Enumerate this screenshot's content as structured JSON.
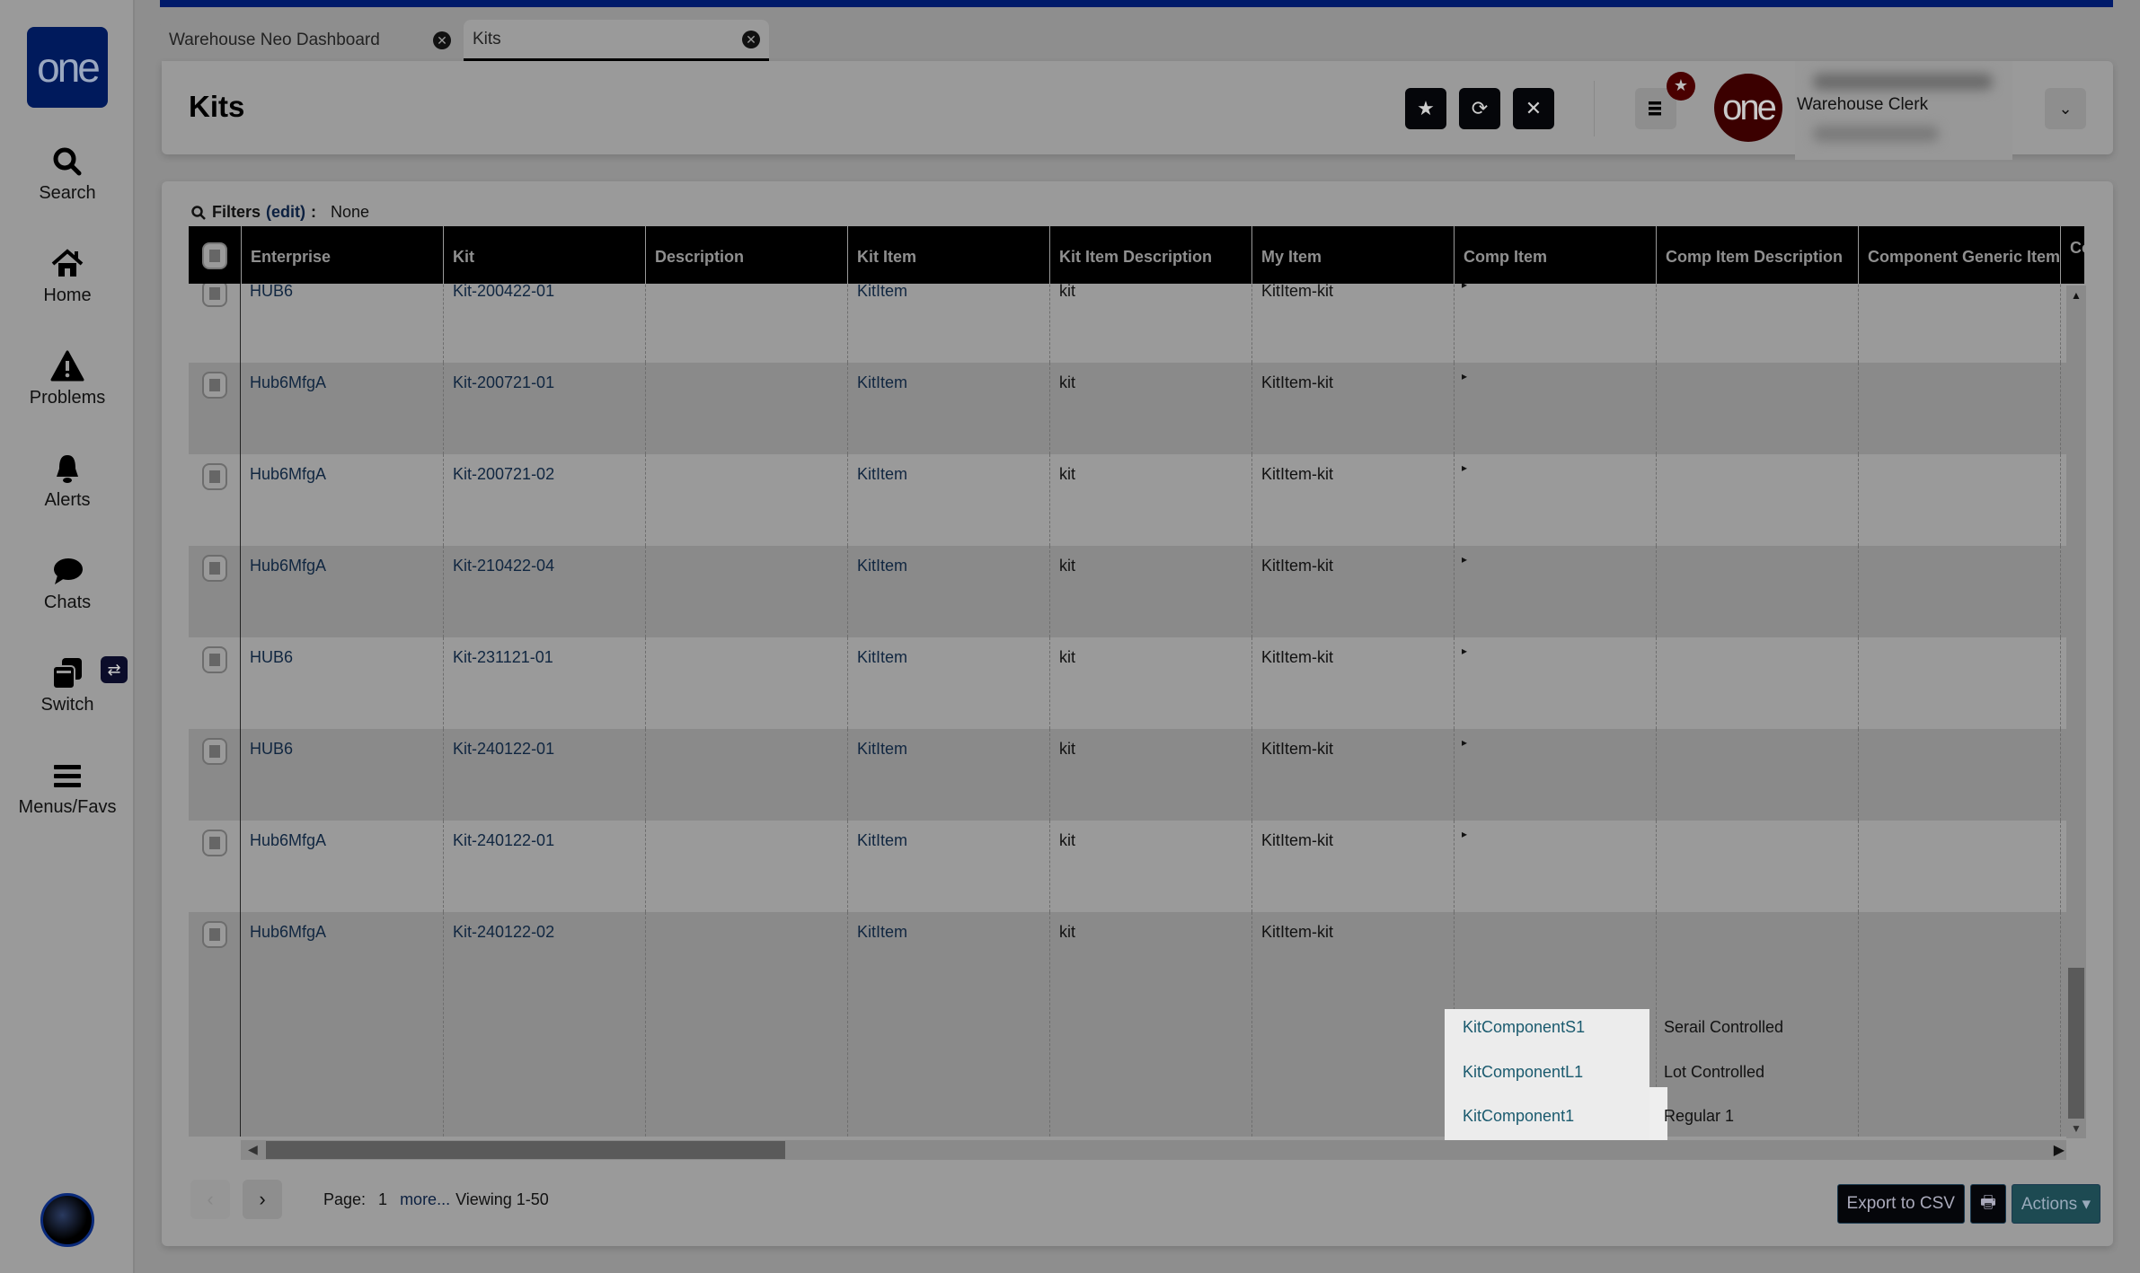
{
  "sidebar": {
    "logo_text": "one",
    "items": [
      {
        "label": "Search",
        "icon": "search-icon"
      },
      {
        "label": "Home",
        "icon": "home-icon"
      },
      {
        "label": "Problems",
        "icon": "warning-icon"
      },
      {
        "label": "Alerts",
        "icon": "bell-icon"
      },
      {
        "label": "Chats",
        "icon": "chat-bubble-icon"
      },
      {
        "label": "Switch",
        "icon": "switch-windows-icon"
      },
      {
        "label": "Menus/Favs",
        "icon": "hamburger-menu-icon"
      }
    ],
    "switch_badge_glyph": "⇄"
  },
  "tabs": [
    {
      "label": "Warehouse Neo Dashboard",
      "active": false
    },
    {
      "label": "Kits",
      "active": true
    }
  ],
  "header": {
    "title": "Kits",
    "favorite_glyph": "★",
    "refresh_glyph": "⟳",
    "close_glyph": "✕",
    "menu_badge_glyph": "★",
    "brand_text": "one",
    "user_role": "Warehouse Clerk",
    "dropdown_glyph": "⌄"
  },
  "filters": {
    "label": "Filters",
    "edit_label": "(edit)",
    "colon": ":",
    "value": "None"
  },
  "grid": {
    "columns": [
      "Enterprise",
      "Kit",
      "Description",
      "Kit Item",
      "Kit Item Description",
      "My Item",
      "Comp Item",
      "Comp Item Description",
      "Component Generic Item",
      "Co De"
    ],
    "rows": [
      {
        "enterprise": "HUB6",
        "kit": "Kit-200422-01",
        "description": "",
        "kit_item": "KitItem",
        "kit_item_desc": "kit",
        "my_item": "KitItem-kit"
      },
      {
        "enterprise": "Hub6MfgA",
        "kit": "Kit-200721-01",
        "description": "",
        "kit_item": "KitItem",
        "kit_item_desc": "kit",
        "my_item": "KitItem-kit"
      },
      {
        "enterprise": "Hub6MfgA",
        "kit": "Kit-200721-02",
        "description": "",
        "kit_item": "KitItem",
        "kit_item_desc": "kit",
        "my_item": "KitItem-kit"
      },
      {
        "enterprise": "Hub6MfgA",
        "kit": "Kit-210422-04",
        "description": "",
        "kit_item": "KitItem",
        "kit_item_desc": "kit",
        "my_item": "KitItem-kit"
      },
      {
        "enterprise": "HUB6",
        "kit": "Kit-231121-01",
        "description": "",
        "kit_item": "KitItem",
        "kit_item_desc": "kit",
        "my_item": "KitItem-kit"
      },
      {
        "enterprise": "HUB6",
        "kit": "Kit-240122-01",
        "description": "",
        "kit_item": "KitItem",
        "kit_item_desc": "kit",
        "my_item": "KitItem-kit"
      },
      {
        "enterprise": "Hub6MfgA",
        "kit": "Kit-240122-01",
        "description": "",
        "kit_item": "KitItem",
        "kit_item_desc": "kit",
        "my_item": "KitItem-kit"
      },
      {
        "enterprise": "Hub6MfgA",
        "kit": "Kit-240122-02",
        "description": "",
        "kit_item": "KitItem",
        "kit_item_desc": "kit",
        "my_item": "KitItem-kit"
      }
    ],
    "expanded_components": [
      {
        "comp_item": "KitComponentS1",
        "comp_item_description": "Serail Controlled"
      },
      {
        "comp_item": "KitComponentL1",
        "comp_item_description": "Lot Controlled"
      },
      {
        "comp_item": "KitComponent1",
        "comp_item_description": "Regular 1"
      }
    ]
  },
  "pager": {
    "prev_glyph": "‹",
    "next_glyph": "›",
    "page_label": "Page:",
    "page_number": "1",
    "more_label": "more...",
    "viewing": "Viewing 1-50"
  },
  "footer": {
    "export_label": "Export to CSV",
    "print_glyph": "🖶",
    "actions_label": "Actions ▾"
  }
}
